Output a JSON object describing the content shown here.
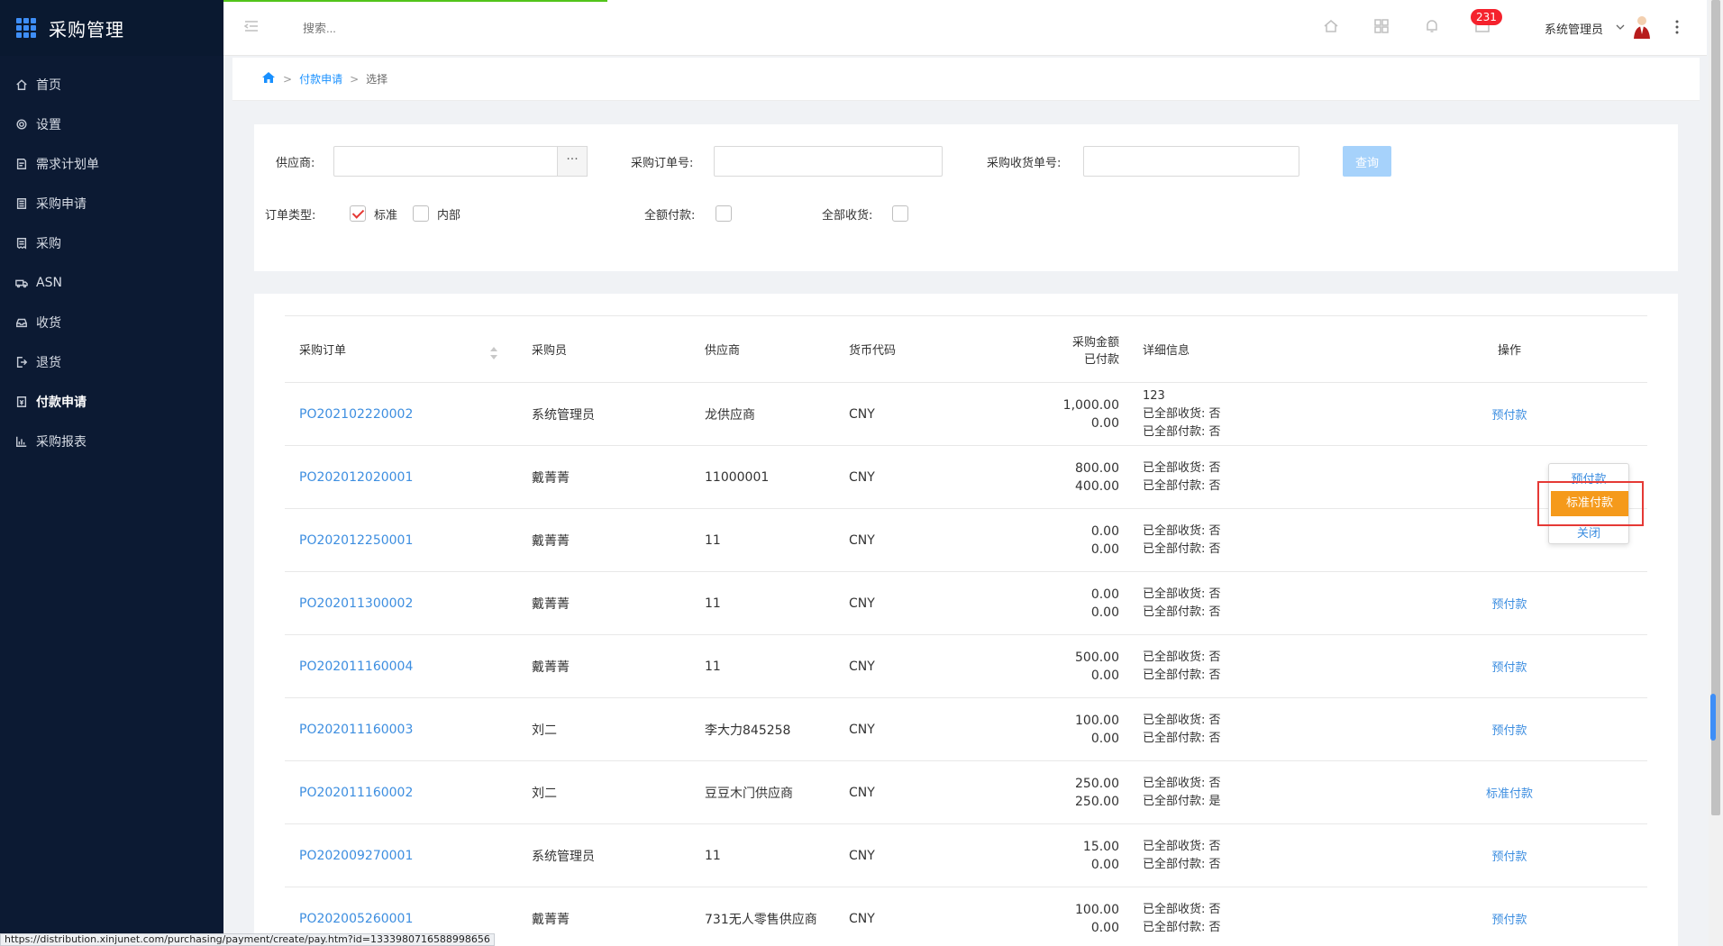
{
  "app": {
    "title": "采购管理"
  },
  "sidebar": {
    "items": [
      {
        "label": "首页",
        "icon": "home-icon"
      },
      {
        "label": "设置",
        "icon": "gear-icon"
      },
      {
        "label": "需求计划单",
        "icon": "doc-icon"
      },
      {
        "label": "采购申请",
        "icon": "list-icon"
      },
      {
        "label": "采购",
        "icon": "receipt-icon"
      },
      {
        "label": "ASN",
        "icon": "truck-icon"
      },
      {
        "label": "收货",
        "icon": "inbox-icon"
      },
      {
        "label": "退货",
        "icon": "return-icon"
      },
      {
        "label": "付款申请",
        "icon": "payment-icon",
        "active": true
      },
      {
        "label": "采购报表",
        "icon": "bar-chart-icon"
      }
    ]
  },
  "topbar": {
    "search_placeholder": "搜索...",
    "badge_count": "231",
    "user_name": "系统管理员"
  },
  "breadcrumb": {
    "link": "付款申请",
    "current": "选择",
    "sep": ">"
  },
  "filter": {
    "supplier_label": "供应商:",
    "po_label": "采购订单号:",
    "receipt_label": "采购收货单号:",
    "query_label": "查询",
    "ellipsis": "···",
    "order_type_label": "订单类型:",
    "type_standard": "标准",
    "type_internal": "内部",
    "full_payment_label": "全额付款:",
    "full_receipt_label": "全部收货:"
  },
  "table": {
    "headers": {
      "po": "采购订单",
      "buyer": "采购员",
      "supplier": "供应商",
      "currency": "货币代码",
      "amount": "采购金额",
      "paid": "已付款",
      "detail": "详细信息",
      "op": "操作"
    },
    "rows": [
      {
        "po": "PO202102220002",
        "buyer": "系统管理员",
        "supplier": "龙供应商",
        "currency": "CNY",
        "amount": "1,000.00",
        "paid": "0.00",
        "note": "123",
        "recv": "已全部收货: 否",
        "payd": "已全部付款: 否",
        "op": "预付款"
      },
      {
        "po": "PO202012020001",
        "buyer": "戴菁菁",
        "supplier": "11000001",
        "currency": "CNY",
        "amount": "800.00",
        "paid": "400.00",
        "note": "",
        "recv": "已全部收货: 否",
        "payd": "已全部付款: 否",
        "op": ""
      },
      {
        "po": "PO202012250001",
        "buyer": "戴菁菁",
        "supplier": "11",
        "currency": "CNY",
        "amount": "0.00",
        "paid": "0.00",
        "note": "",
        "recv": "已全部收货: 否",
        "payd": "已全部付款: 否",
        "op": ""
      },
      {
        "po": "PO202011300002",
        "buyer": "戴菁菁",
        "supplier": "11",
        "currency": "CNY",
        "amount": "0.00",
        "paid": "0.00",
        "note": "",
        "recv": "已全部收货: 否",
        "payd": "已全部付款: 否",
        "op": "预付款"
      },
      {
        "po": "PO202011160004",
        "buyer": "戴菁菁",
        "supplier": "11",
        "currency": "CNY",
        "amount": "500.00",
        "paid": "0.00",
        "note": "",
        "recv": "已全部收货: 否",
        "payd": "已全部付款: 否",
        "op": "预付款"
      },
      {
        "po": "PO202011160003",
        "buyer": "刘二",
        "supplier": "李大力845258",
        "currency": "CNY",
        "amount": "100.00",
        "paid": "0.00",
        "note": "",
        "recv": "已全部收货: 否",
        "payd": "已全部付款: 否",
        "op": "预付款"
      },
      {
        "po": "PO202011160002",
        "buyer": "刘二",
        "supplier": "豆豆木门供应商",
        "currency": "CNY",
        "amount": "250.00",
        "paid": "250.00",
        "note": "",
        "recv": "已全部收货: 否",
        "payd": "已全部付款: 是",
        "op": "标准付款"
      },
      {
        "po": "PO202009270001",
        "buyer": "系统管理员",
        "supplier": "11",
        "currency": "CNY",
        "amount": "15.00",
        "paid": "0.00",
        "note": "",
        "recv": "已全部收货: 否",
        "payd": "已全部付款: 否",
        "op": "预付款"
      },
      {
        "po": "PO202005260001",
        "buyer": "戴菁菁",
        "supplier": "731无人零售供应商",
        "currency": "CNY",
        "amount": "100.00",
        "paid": "0.00",
        "note": "",
        "recv": "已全部收货: 否",
        "payd": "已全部付款: 否",
        "op": "预付款"
      }
    ]
  },
  "popover": {
    "items": [
      "预付款",
      "标准付款",
      "关闭"
    ]
  },
  "status_url": "https://distribution.xinjunet.com/purchasing/payment/create/pay.htm?id=1333980716588998656",
  "colors": {
    "sidebar_bg": "#0c1a33",
    "link": "#3d8ee0",
    "highlight": "#f59a1b",
    "badge": "#f5222d",
    "callout": "#e53935"
  }
}
